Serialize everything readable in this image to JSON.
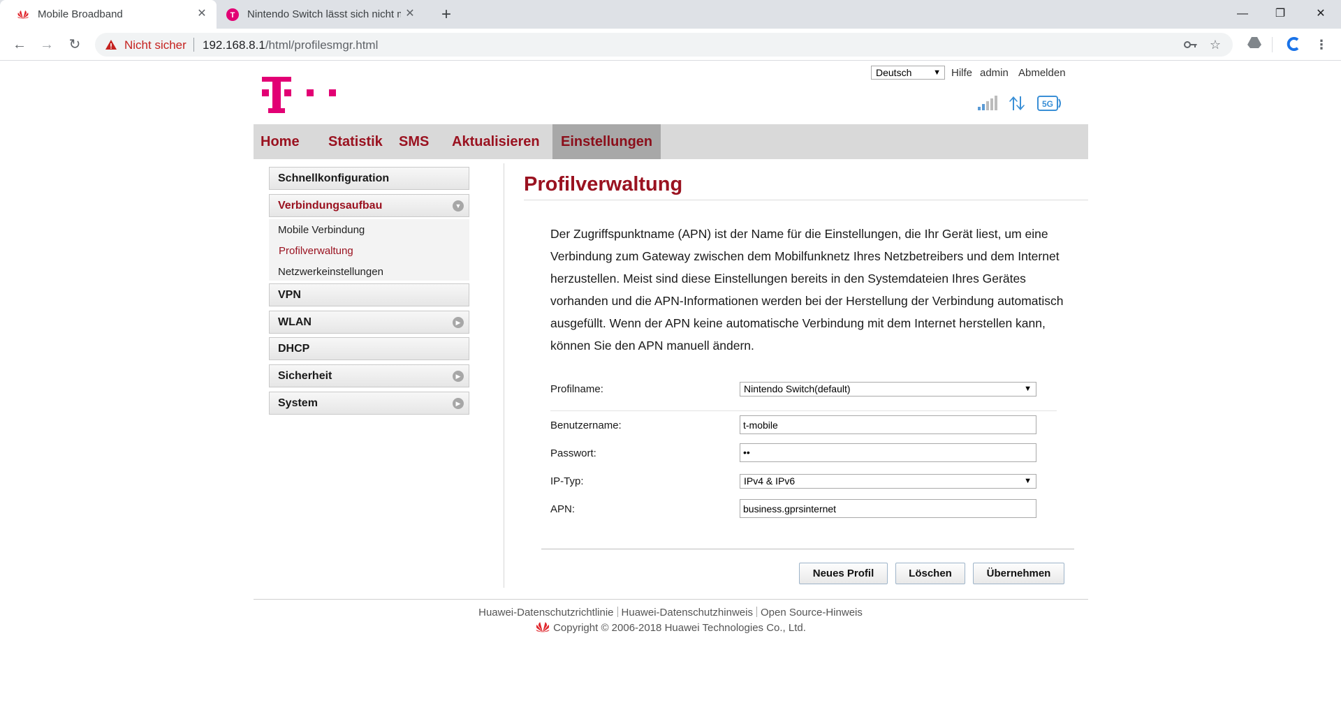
{
  "browser": {
    "tabs": [
      {
        "title": "Mobile Broadband",
        "active": true
      },
      {
        "title": "Nintendo Switch lässt sich nicht m",
        "active": false
      }
    ],
    "security_label": "Nicht sicher",
    "url_host": "192.168.8.1",
    "url_path": "/html/profilesmgr.html"
  },
  "header": {
    "language": "Deutsch",
    "help": "Hilfe",
    "user": "admin",
    "logout": "Abmelden",
    "network_type": "5G"
  },
  "nav": {
    "items": [
      "Home",
      "Statistik",
      "SMS",
      "Aktualisieren",
      "Einstellungen"
    ],
    "active": "Einstellungen"
  },
  "sidebar": {
    "items": [
      {
        "label": "Schnellkonfiguration"
      },
      {
        "label": "Verbindungsaufbau"
      },
      {
        "label": "VPN"
      },
      {
        "label": "WLAN"
      },
      {
        "label": "DHCP"
      },
      {
        "label": "Sicherheit"
      },
      {
        "label": "System"
      }
    ],
    "submenu": [
      "Mobile Verbindung",
      "Profilverwaltung",
      "Netzwerkeinstellungen"
    ]
  },
  "content": {
    "title": "Profilverwaltung",
    "description": "Der Zugriffspunktname (APN) ist der Name für die Einstellungen, die Ihr Gerät liest, um eine Verbindung zum Gateway zwischen dem Mobilfunknetz Ihres Netzbetreibers und dem Internet herzustellen. Meist sind diese Einstellungen bereits in den Systemdateien Ihres Gerätes vorhanden und die APN-Informationen werden bei der Herstellung der Verbindung automatisch ausgefüllt. Wenn der APN keine automatische Verbindung mit dem Internet herstellen kann, können Sie den APN manuell ändern."
  },
  "form": {
    "profile_label": "Profilname:",
    "profile_value": "Nintendo Switch(default)",
    "username_label": "Benutzername:",
    "username_value": "t-mobile",
    "password_label": "Passwort:",
    "password_value": "••",
    "iptype_label": "IP-Typ:",
    "iptype_value": "IPv4 & IPv6",
    "apn_label": "APN:",
    "apn_value": "business.gprsinternet"
  },
  "buttons": {
    "new_profile": "Neues Profil",
    "delete": "Löschen",
    "apply": "Übernehmen"
  },
  "footer": {
    "privacy_policy": "Huawei-Datenschutzrichtlinie",
    "privacy_notice": "Huawei-Datenschutzhinweis",
    "open_source": "Open Source-Hinweis",
    "copyright": "Copyright © 2006-2018 Huawei Technologies Co., Ltd."
  },
  "colors": {
    "telekom_magenta": "#e20074",
    "nav_red": "#9a1220",
    "huawei_red": "#e0272d"
  }
}
